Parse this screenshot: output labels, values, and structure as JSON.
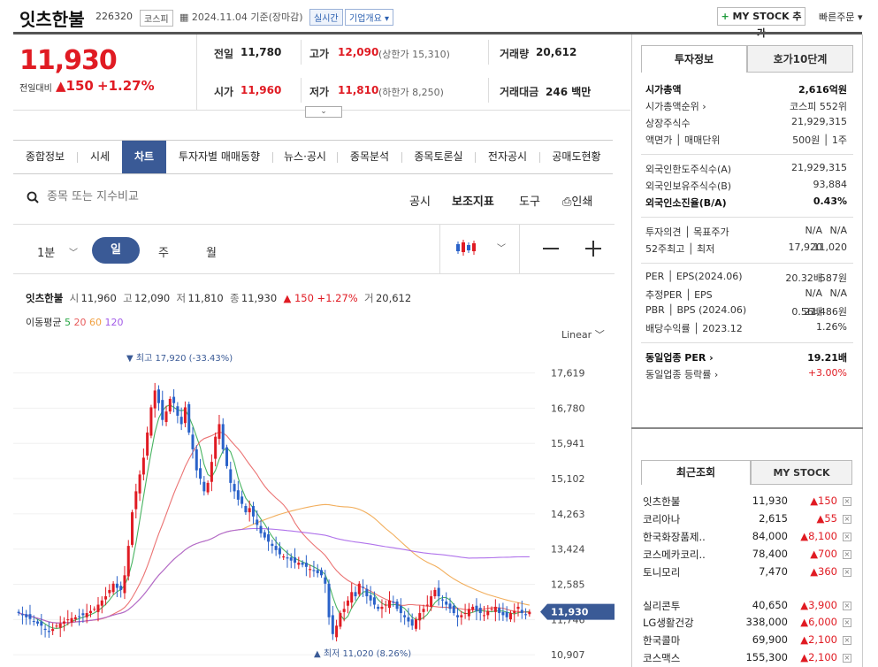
{
  "header": {
    "stock_name": "잇츠한불",
    "stock_code": "226320",
    "market_tag": "코스피",
    "date_text": "2024.11.04  기준(장마감)",
    "live_tag": "실시간",
    "corp_overview": "기업개요 ▾",
    "mystock_button": "MY STOCK 추가",
    "quick_order": "빠른주문 ▾"
  },
  "price": {
    "current": "11,930",
    "diff_label": "전일대비",
    "diff_value": "▲150",
    "diff_pct": "+1.27%"
  },
  "quote": {
    "prev_label": "전일",
    "prev": "11,780",
    "high_label": "고가",
    "high": "12,090",
    "upper_limit": "(상한가 15,310)",
    "volume_label": "거래량",
    "volume": "20,612",
    "open_label": "시가",
    "open": "11,960",
    "low_label": "저가",
    "low": "11,810",
    "lower_limit": "(하한가 8,250)",
    "amount_label": "거래대금",
    "amount": "246 백만"
  },
  "tabs": [
    "종합정보",
    "시세",
    "차트",
    "투자자별 매매동향",
    "뉴스·공시",
    "종목분석",
    "종목토론실",
    "전자공시",
    "공매도현황"
  ],
  "active_tab": "차트",
  "toolbar": {
    "search_placeholder": "종목 또는 지수비교",
    "disclosure": "공시",
    "indicator": "보조지표",
    "tools": "도구",
    "print": "인쇄"
  },
  "periods": {
    "minute": "1분",
    "day": "일",
    "week": "주",
    "month": "월"
  },
  "chart_info": {
    "name": "잇츠한불",
    "open_l": "시",
    "open": "11,960",
    "high_l": "고",
    "high": "12,090",
    "low_l": "저",
    "low": "11,810",
    "close_l": "종",
    "close": "11,930",
    "change": "▲ 150 +1.27%",
    "vol_l": "거",
    "vol": "20,612",
    "ma_label": "이동평균",
    "ma": [
      "5",
      "20",
      "60",
      "120"
    ],
    "ma_colors": [
      "#28a745",
      "#e85a5a",
      "#f0a040",
      "#a25ae8"
    ],
    "scale": "Linear"
  },
  "chart_data": {
    "type": "candlestick",
    "y_ticks": [
      17619,
      16780,
      15941,
      15102,
      14263,
      13424,
      12585,
      11746,
      10907
    ],
    "ylim": [
      10700,
      18200
    ],
    "current_label": "11,930",
    "max_label": "▼ 최고 17,920 (-33.43%)",
    "min_label": "▲ 최저 11,020 (8.26%)",
    "up_color": "#e01b23",
    "down_color": "#2a62c9",
    "closes": [
      11900,
      11850,
      11800,
      11760,
      11700,
      11650,
      11600,
      11500,
      11450,
      11520,
      11600,
      11650,
      11700,
      11750,
      11780,
      11800,
      11820,
      11850,
      11900,
      11950,
      12000,
      12100,
      12200,
      12300,
      12450,
      12600,
      12500,
      12450,
      12800,
      13500,
      14300,
      14800,
      15200,
      15600,
      16200,
      16800,
      17200,
      16900,
      16500,
      16700,
      17000,
      16900,
      16600,
      16400,
      16800,
      16200,
      15800,
      15300,
      15100,
      14800,
      15000,
      15500,
      16100,
      16400,
      15800,
      15400,
      15000,
      14800,
      14600,
      14500,
      14300,
      14400,
      14200,
      14000,
      13800,
      13700,
      13600,
      13500,
      13400,
      13300,
      13250,
      13200,
      13150,
      13100,
      13100,
      13050,
      13000,
      12950,
      12900,
      12850,
      12800,
      12600,
      11800,
      11400,
      11600,
      11900,
      12000,
      12200,
      12400,
      12300,
      12600,
      12500,
      12300,
      12200,
      12100,
      12000,
      12050,
      12100,
      12200,
      12150,
      12000,
      11900,
      11800,
      11700,
      11600,
      11750,
      11900,
      12000,
      12100,
      12300,
      12450,
      12300,
      12200,
      12100,
      12000,
      11900,
      11800,
      11850,
      11900,
      12000,
      12050,
      11950,
      11900,
      11850,
      11950,
      12000,
      12050,
      11900,
      11850,
      11800,
      11900,
      11950,
      12050,
      11900,
      11850,
      11930
    ]
  },
  "invest_info": {
    "tab_active": "투자정보",
    "tab_other": "호가10단계",
    "rows": [
      {
        "l": "시가총액",
        "r": "2,616억원",
        "bold": true
      },
      {
        "l": "시가총액순위 ›",
        "r": "코스피 552위"
      },
      {
        "l": "상장주식수",
        "r": "21,929,315"
      },
      {
        "l": "액면가 │ 매매단위",
        "r": "500원 │ 1주"
      },
      {
        "l": "외국인한도주식수(A)",
        "r": "21,929,315"
      },
      {
        "l": "외국인보유주식수(B)",
        "r": "93,884"
      },
      {
        "l": "외국인소진율(B/A)",
        "r": "0.43%",
        "bold": true
      },
      {
        "l": "투자의견 │ 목표주가",
        "m": "N/A",
        "r": "N/A"
      },
      {
        "l": "52주최고 │ 최저",
        "m": "17,920",
        "r": "11,020"
      },
      {
        "l": "PER │ EPS(2024.06)",
        "m": "20.32배",
        "r": "587원"
      },
      {
        "l": "추정PER │ EPS",
        "m": "N/A",
        "r": "N/A"
      },
      {
        "l": "PBR │ BPS (2024.06)",
        "m": "0.56배",
        "r": "21,486원"
      },
      {
        "l": "배당수익률 │ 2023.12",
        "r": "1.26%"
      },
      {
        "l": "동일업종 PER ›",
        "r": "19.21배",
        "bold": true
      },
      {
        "l": "동일업종 등락률 ›",
        "r": "+3.00%",
        "red": true
      }
    ]
  },
  "recent": {
    "tab_active": "최근조회",
    "tab_other": "MY STOCK",
    "items": [
      {
        "name": "잇츠한불",
        "price": "11,930",
        "chg": "▲150"
      },
      {
        "name": "코리아나",
        "price": "2,615",
        "chg": "▲55"
      },
      {
        "name": "한국화장품제..",
        "price": "84,000",
        "chg": "▲8,100"
      },
      {
        "name": "코스메카코리..",
        "price": "78,400",
        "chg": "▲700"
      },
      {
        "name": "토니모리",
        "price": "7,470",
        "chg": "▲360"
      },
      {
        "name": "실리콘투",
        "price": "40,650",
        "chg": "▲3,900"
      },
      {
        "name": "LG생활건강",
        "price": "338,000",
        "chg": "▲6,000"
      },
      {
        "name": "한국콜마",
        "price": "69,900",
        "chg": "▲2,100"
      },
      {
        "name": "코스맥스",
        "price": "155,300",
        "chg": "▲2,100"
      }
    ]
  }
}
